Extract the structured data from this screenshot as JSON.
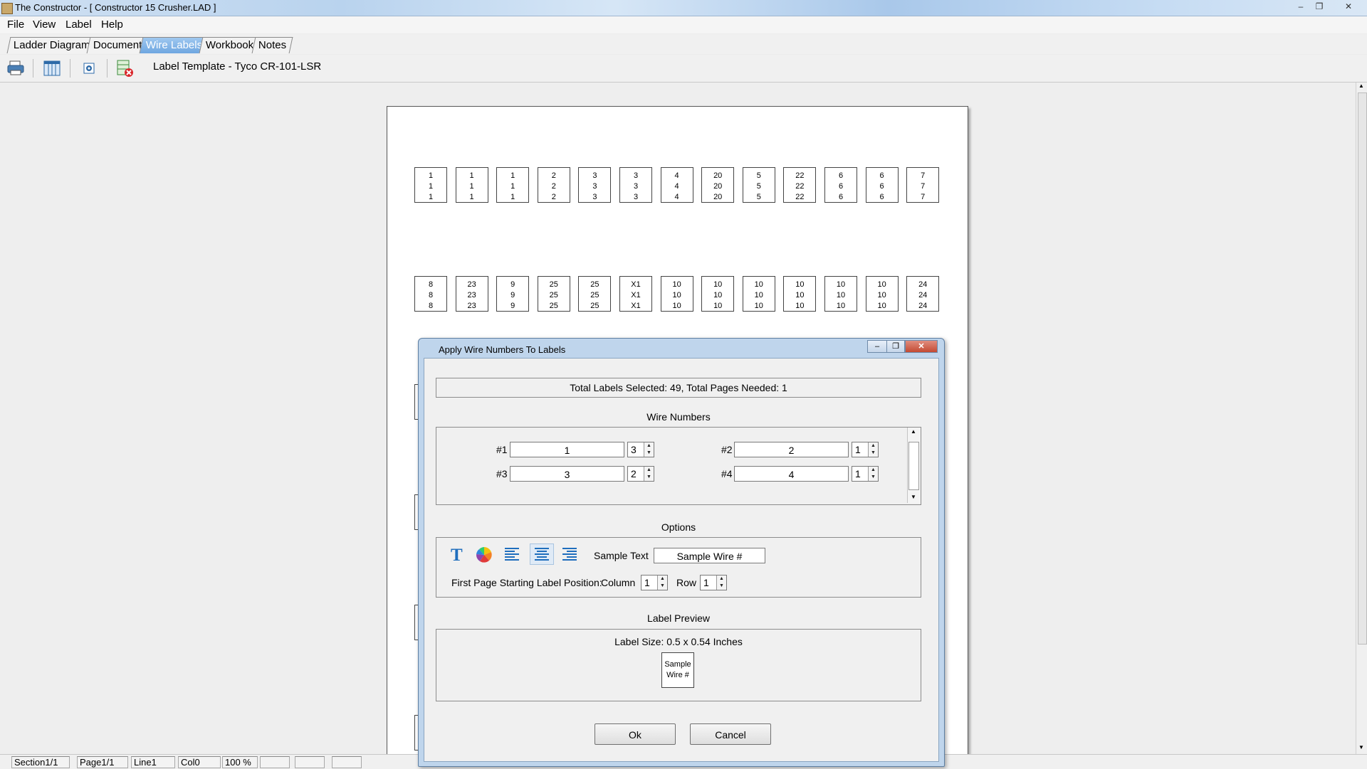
{
  "window": {
    "title": "The Constructor  -  [ Constructor 15 Crusher.LAD ]",
    "controls": [
      "–",
      "❐",
      "✕"
    ]
  },
  "menubar": [
    "File",
    "View",
    "Label",
    "Help"
  ],
  "tabs": [
    {
      "label": "Ladder Diagram",
      "active": false
    },
    {
      "label": "Document",
      "active": false
    },
    {
      "label": "Wire Labels",
      "active": true
    },
    {
      "label": "Workbook",
      "active": false
    },
    {
      "label": "Notes",
      "active": false
    }
  ],
  "toolbar": {
    "icons": [
      "print-icon",
      "grid-icon",
      "settings-icon",
      "delete-labels-icon"
    ],
    "template_label": "Label Template - Tyco CR-101-LSR"
  },
  "labels": {
    "row1": [
      "1",
      "1",
      "1",
      "2",
      "3",
      "3",
      "4",
      "20",
      "5",
      "22",
      "6",
      "6",
      "7"
    ],
    "row2": [
      "8",
      "23",
      "9",
      "25",
      "25",
      "X1",
      "10",
      "10",
      "10",
      "10",
      "10",
      "10",
      "24"
    ]
  },
  "statusbar": [
    "Section1/1",
    "Page1/1",
    "Line1",
    "Col0",
    "100 %",
    "",
    "",
    ""
  ],
  "dialog": {
    "title": "Apply Wire Numbers To Labels",
    "summary": "Total Labels Selected: 49,   Total Pages Needed: 1",
    "wire_numbers": {
      "title": "Wire Numbers",
      "entries": [
        {
          "label": "#1",
          "value": "1",
          "count": "3"
        },
        {
          "label": "#2",
          "value": "2",
          "count": "1"
        },
        {
          "label": "#3",
          "value": "3",
          "count": "2"
        },
        {
          "label": "#4",
          "value": "4",
          "count": "1"
        }
      ]
    },
    "options": {
      "title": "Options",
      "icons": [
        "font-icon",
        "color-wheel-icon",
        "align-left-icon",
        "align-center-icon",
        "align-right-icon"
      ],
      "sample_text_label": "Sample Text",
      "sample_text_value": "Sample Wire #",
      "start_position_label": "First Page Starting Label Position:",
      "column_label": "Column",
      "column_value": "1",
      "row_label": "Row",
      "row_value": "1"
    },
    "preview": {
      "title": "Label Preview",
      "size_text": "Label Size: 0.5 x 0.54 Inches",
      "sample_line1": "Sample",
      "sample_line2": "Wire #"
    },
    "ok_label": "Ok",
    "cancel_label": "Cancel"
  }
}
